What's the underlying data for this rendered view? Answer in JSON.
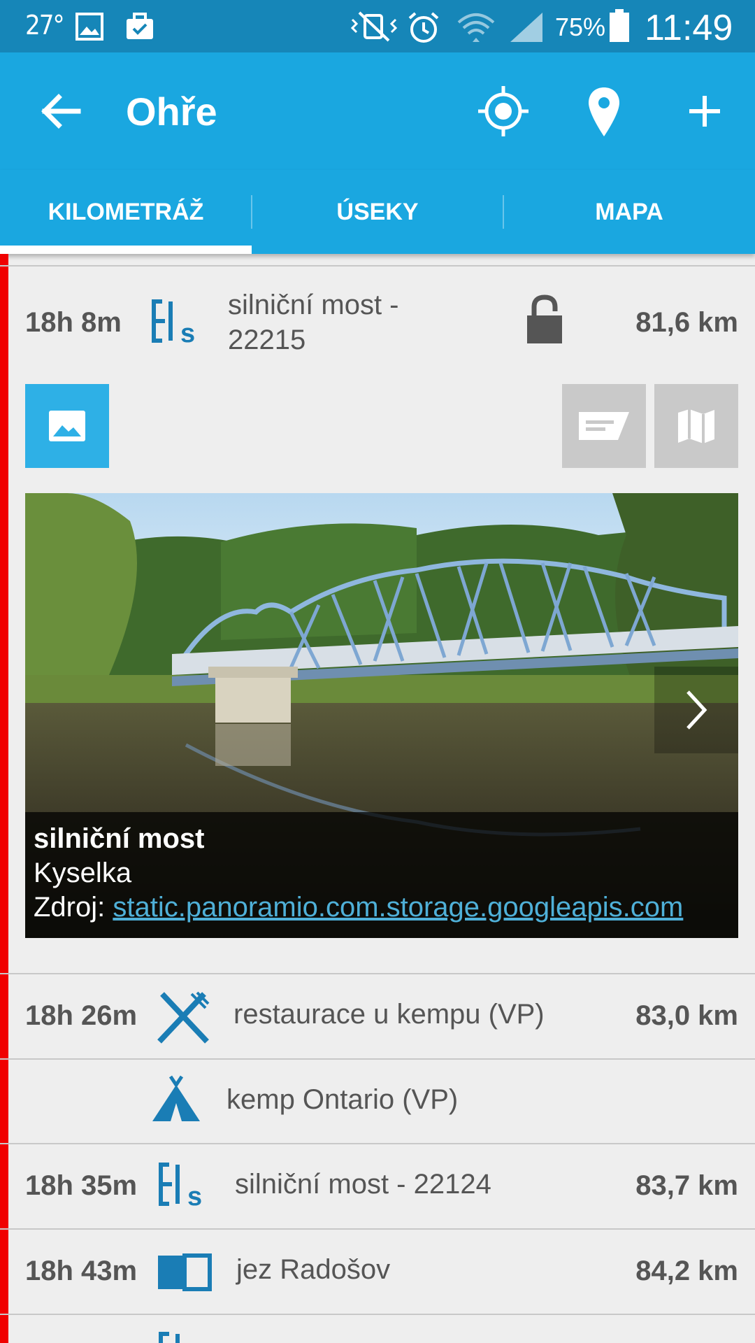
{
  "status_bar": {
    "temperature": "27°",
    "battery": "75%",
    "time": "11:49"
  },
  "app_bar": {
    "title": "Ohře"
  },
  "tabs": [
    {
      "label": "KILOMETRÁŽ",
      "selected": true
    },
    {
      "label": "ÚSEKY",
      "selected": false
    },
    {
      "label": "MAPA",
      "selected": false
    }
  ],
  "detail": {
    "time": "18h 8m",
    "name_line1": "silniční most -",
    "name_line2": "22215",
    "distance": "81,6 km",
    "icon": "bridge-icon",
    "photo": {
      "title": "silniční most",
      "subtitle": "Kyselka",
      "source_label": "Zdroj: ",
      "source_link": "static.panoramio.com.storage.googleapis.com"
    }
  },
  "items": [
    {
      "time": "18h 26m",
      "name": "restaurace u kempu (VP)",
      "distance": "83,0 km",
      "icon": "restaurant-icon"
    },
    {
      "time": "",
      "name": "kemp Ontario (VP)",
      "distance": "",
      "icon": "camp-icon"
    },
    {
      "time": "18h 35m",
      "name": "silniční most - 22124",
      "distance": "83,7 km",
      "icon": "bridge-icon"
    },
    {
      "time": "18h 43m",
      "name": "jez Radošov",
      "distance": "84,2 km",
      "icon": "weir-icon"
    }
  ],
  "colors": {
    "primary": "#1aa7e0",
    "status_bar": "#1686b8",
    "accent_red": "#f00000",
    "icon_blue": "#1a7db5"
  }
}
